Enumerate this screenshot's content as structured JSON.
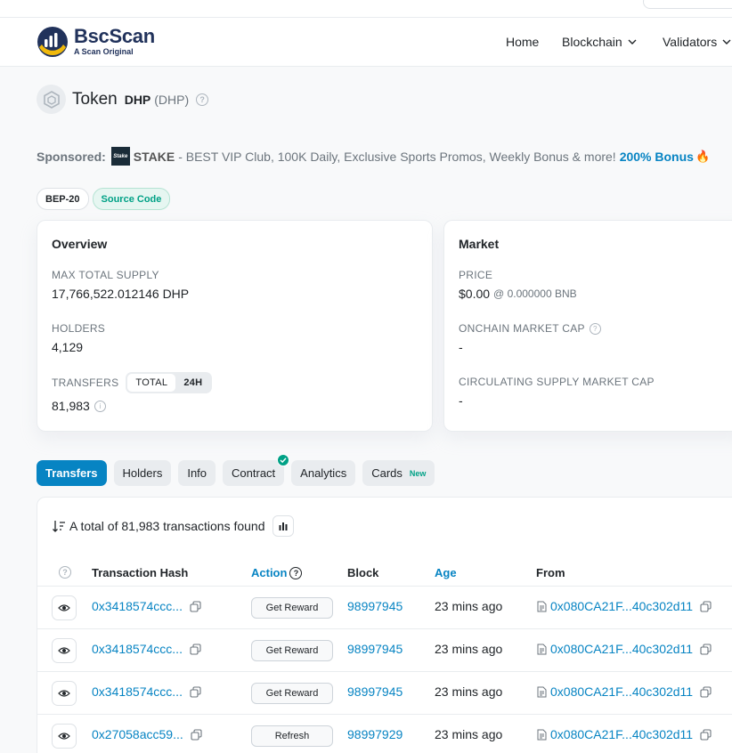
{
  "nav": {
    "brand": "BscScan",
    "brand_sub": "A Scan Original",
    "items": [
      "Home",
      "Blockchain",
      "Validators"
    ]
  },
  "token": {
    "label": "Token",
    "name": "DHP",
    "symbol": "(DHP)"
  },
  "sponsored": {
    "label": "Sponsored:",
    "logo_text": "Stake",
    "brand": "STAKE",
    "text": "- BEST VIP Club, 100K Daily, Exclusive Sports Promos, Weekly Bonus & more!",
    "bonus": "200% Bonus"
  },
  "tags": [
    "BEP-20",
    "Source Code"
  ],
  "overview": {
    "title": "Overview",
    "max_supply_label": "MAX TOTAL SUPPLY",
    "max_supply_value": "17,766,522.012146 DHP",
    "holders_label": "HOLDERS",
    "holders_value": "4,129",
    "transfers_label": "TRANSFERS",
    "seg_total": "TOTAL",
    "seg_24h": "24H",
    "transfers_value": "81,983"
  },
  "market": {
    "title": "Market",
    "price_label": "PRICE",
    "price_value": "$0.00",
    "price_bnb": "@ 0.000000 BNB",
    "mcap_label": "ONCHAIN MARKET CAP",
    "mcap_value": "-",
    "circ_label": "CIRCULATING SUPPLY MARKET CAP",
    "circ_value": "-"
  },
  "tabs": {
    "transfers": "Transfers",
    "holders": "Holders",
    "info": "Info",
    "contract": "Contract",
    "analytics": "Analytics",
    "cards": "Cards",
    "cards_badge": "New"
  },
  "table": {
    "summary": "A total of 81,983 transactions found",
    "headers": {
      "hash": "Transaction Hash",
      "action": "Action",
      "block": "Block",
      "age": "Age",
      "from": "From"
    },
    "rows": [
      {
        "hash": "0x3418574ccc...",
        "action": "Get Reward",
        "block": "98997945",
        "age": "23 mins ago",
        "from": "0x080CA21F...40c302d11"
      },
      {
        "hash": "0x3418574ccc...",
        "action": "Get Reward",
        "block": "98997945",
        "age": "23 mins ago",
        "from": "0x080CA21F...40c302d11"
      },
      {
        "hash": "0x3418574ccc...",
        "action": "Get Reward",
        "block": "98997945",
        "age": "23 mins ago",
        "from": "0x080CA21F...40c302d11"
      },
      {
        "hash": "0x27058acc59...",
        "action": "Refresh",
        "block": "98997929",
        "age": "23 mins ago",
        "from": "0x080CA21F...40c302d11"
      }
    ]
  },
  "colors": {
    "brand_blue": "#0784c3",
    "brand_navy": "#21325b",
    "success": "#00a186"
  }
}
